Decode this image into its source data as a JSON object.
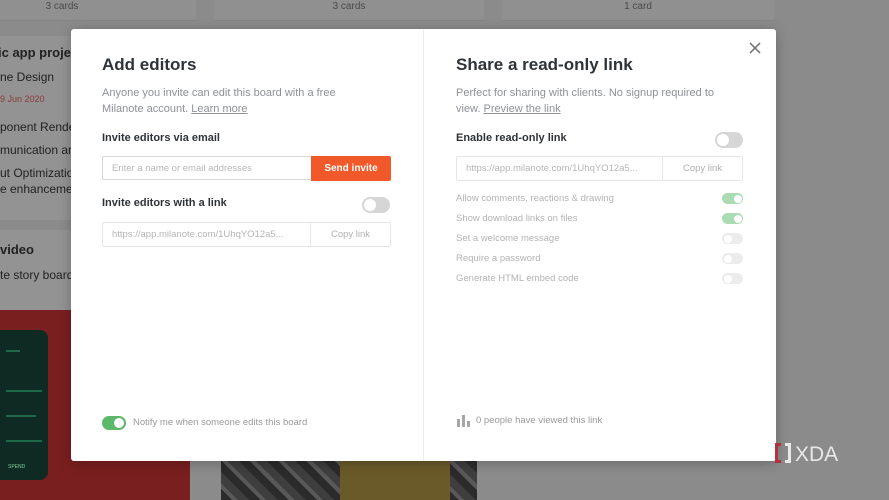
{
  "background": {
    "columns": [
      {
        "count": "3 cards"
      },
      {
        "count": "3 cards"
      },
      {
        "count": "1 card"
      }
    ],
    "card1": {
      "title": "ic app projec",
      "line1": "ne Design",
      "date": "9 Jun 2020",
      "line2": "ponent Rende",
      "line3": "munication an",
      "line4": "ut Optimizatio",
      "line5": "e enhancemer"
    },
    "card2": {
      "title": "video",
      "line1": "te story board"
    },
    "phone_button": "SPEND"
  },
  "modal": {
    "left": {
      "title": "Add editors",
      "description": "Anyone you invite can edit this board with a free Milanote account.",
      "learn_more": "Learn more",
      "email_label": "Invite editors via email",
      "email_placeholder": "Enter a name or email addresses",
      "send_invite": "Send invite",
      "link_label": "Invite editors with a link",
      "link_enabled": false,
      "link_url": "https://app.milanote.com/1UhqYO12a5...",
      "copy_link": "Copy link",
      "notify_text": "Notify me when someone edits this board",
      "notify_enabled": true
    },
    "right": {
      "title": "Share a read-only link",
      "description": "Perfect for sharing with clients. No signup required to view.",
      "preview": "Preview the link",
      "enable_label": "Enable read-only link",
      "enabled": false,
      "link_url": "https://app.milanote.com/1UhqYO12a5...",
      "copy_link": "Copy link",
      "options": [
        {
          "label": "Allow comments, reactions & drawing",
          "on": true
        },
        {
          "label": "Show download links on files",
          "on": true
        },
        {
          "label": "Set a welcome message",
          "on": false
        },
        {
          "label": "Require a password",
          "on": false
        },
        {
          "label": "Generate HTML embed code",
          "on": false
        }
      ],
      "views_text": "0 people have viewed this link"
    },
    "close_icon": "close-icon"
  },
  "watermark": "XDA",
  "colors": {
    "accent": "#f1592a",
    "toggle_on": "#5cb96a",
    "overlay": "#8b8b8b"
  }
}
